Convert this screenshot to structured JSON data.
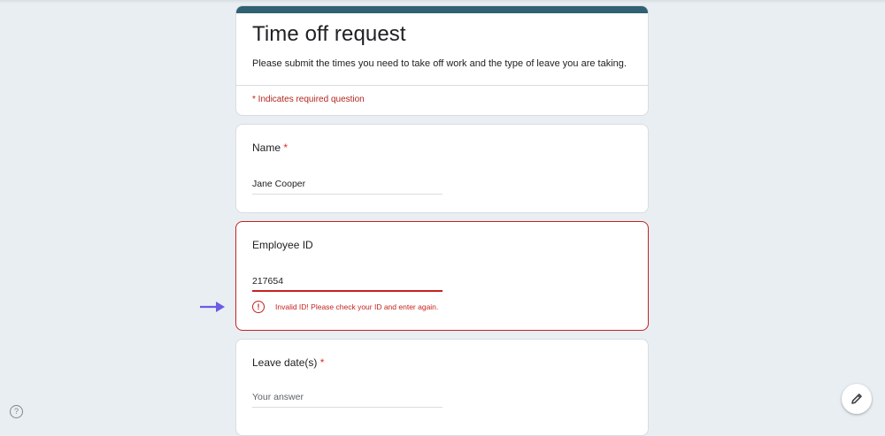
{
  "form": {
    "title": "Time off request",
    "description": "Please submit the times you need to take off work and the type of leave you are taking.",
    "required_note": "* Indicates required question"
  },
  "questions": [
    {
      "label": "Name",
      "required_star": "*",
      "value": "Jane Cooper"
    },
    {
      "label": "Employee ID",
      "value": "217654",
      "error": "Invalid ID! Please check your ID and enter again.",
      "error_icon": "!"
    },
    {
      "label": "Leave date(s)",
      "required_star": "*",
      "placeholder": "Your answer"
    }
  ],
  "help_icon": "?",
  "icons": {
    "error": "error-circle-icon",
    "help": "help-icon",
    "edit": "pencil-icon",
    "pointer": "arrow-right-icon"
  },
  "colors": {
    "accent": "#2f6173",
    "error": "#c5221f",
    "background": "#e9eef2",
    "pointer_arrow": "#6b5be6"
  }
}
